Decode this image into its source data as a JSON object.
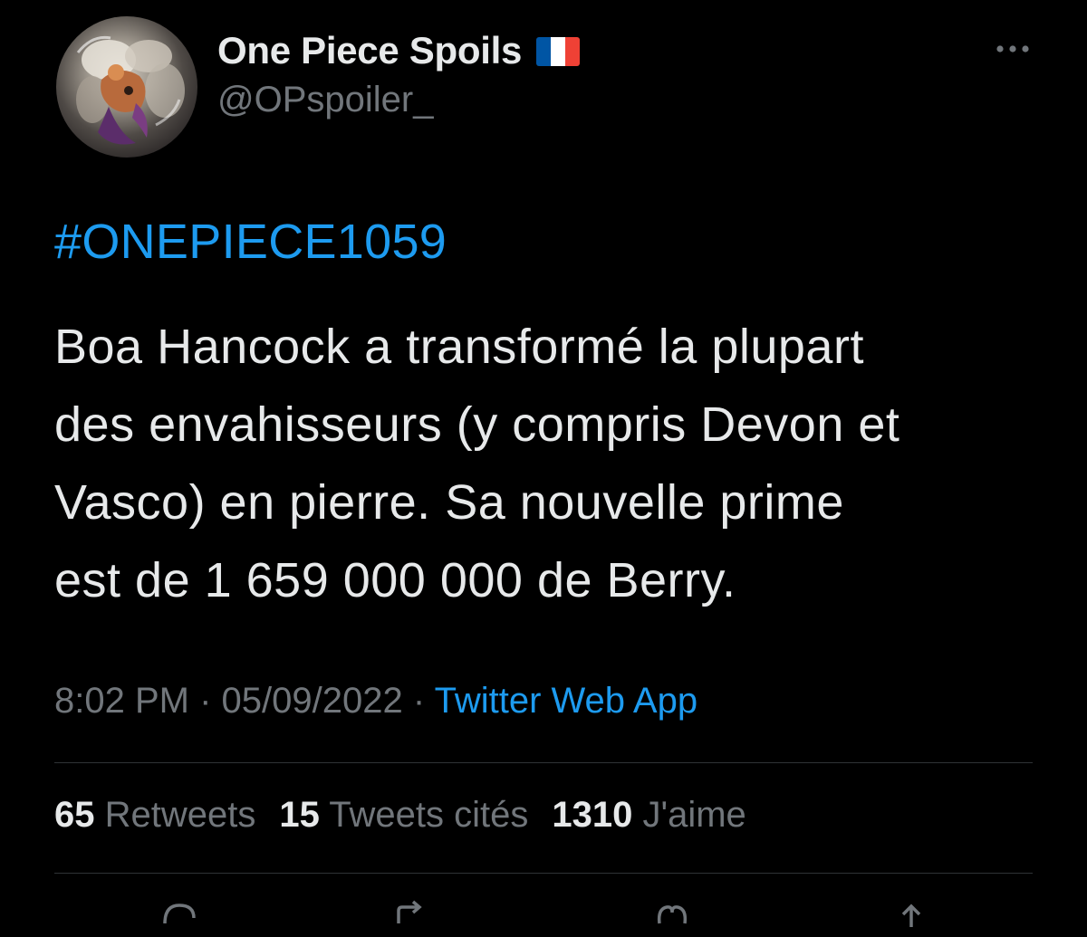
{
  "author": {
    "display_name": "One Piece Spoils",
    "handle": "@OPspoiler_",
    "flag": [
      "#0055a4",
      "#ffffff",
      "#ef4135"
    ]
  },
  "tweet": {
    "hashtag": "#ONEPIECE1059",
    "text_lines": [
      "Boa Hancock a transformé la plupart",
      "des envahisseurs (y compris Devon et",
      "Vasco) en pierre. Sa nouvelle prime",
      "est de 1 659 000 000 de Berry."
    ],
    "time": "8:02 PM",
    "date": "05/09/2022",
    "separator": "·",
    "source": "Twitter Web App"
  },
  "stats": {
    "retweets_count": "65",
    "retweets_label": "Retweets",
    "quotes_count": "15",
    "quotes_label": "Tweets cités",
    "likes_count": "1310",
    "likes_label": "J'aime"
  },
  "icons": {
    "more": "more-icon",
    "reply": "reply-icon",
    "retweet": "retweet-icon",
    "like": "like-icon",
    "share": "share-icon"
  },
  "colors": {
    "background": "#000000",
    "text": "#e7e9ea",
    "muted": "#71767b",
    "link": "#1d9bf0",
    "divider": "#2f3336"
  }
}
